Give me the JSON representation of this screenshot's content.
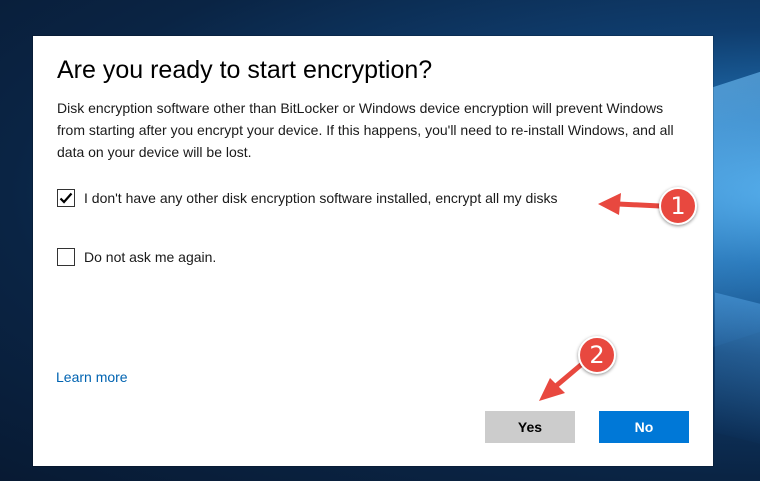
{
  "dialog": {
    "title": "Are you ready to start encryption?",
    "body": "Disk encryption software other than BitLocker or Windows device encryption will prevent Windows from starting after you encrypt your device. If this happens, you'll need to re-install Windows, and all data on your device will be lost.",
    "checkboxes": [
      {
        "label": "I don't have any other disk encryption software installed, encrypt all my disks",
        "checked": true
      },
      {
        "label": "Do not ask me again.",
        "checked": false
      }
    ],
    "learn_more": "Learn more",
    "yes_label": "Yes",
    "no_label": "No"
  },
  "annotations": {
    "step1": "1",
    "step2": "2",
    "color": "#e8483f"
  },
  "colors": {
    "primary_button": "#0078d7",
    "secondary_button": "#cccccc",
    "link": "#0063b1"
  },
  "icons": {
    "checkmark": "checkmark-icon"
  }
}
